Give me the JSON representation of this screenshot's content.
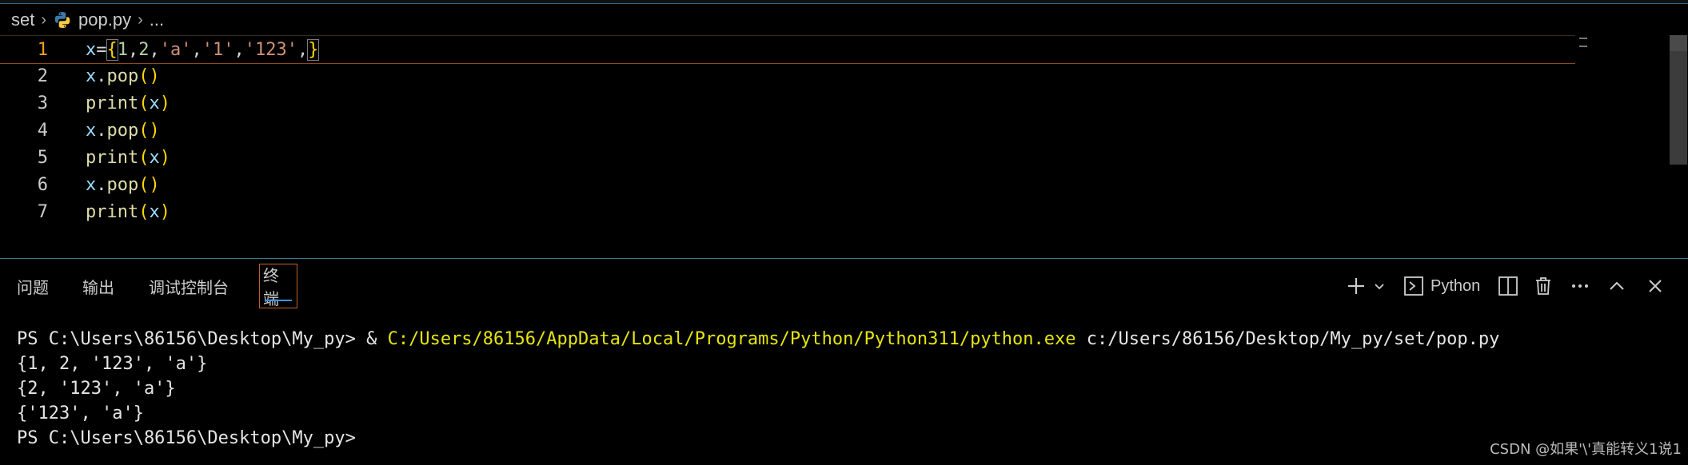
{
  "breadcrumb": {
    "folder": "set",
    "file": "pop.py",
    "more": "..."
  },
  "editor": {
    "lines": [
      {
        "num": "1",
        "tokens": [
          {
            "t": "x",
            "c": "var"
          },
          {
            "t": "=",
            "c": "op"
          },
          {
            "t": "{",
            "c": "brace"
          },
          {
            "t": "1",
            "c": "num"
          },
          {
            "t": ",",
            "c": "punc"
          },
          {
            "t": "2",
            "c": "num"
          },
          {
            "t": ",",
            "c": "punc"
          },
          {
            "t": "'a'",
            "c": "str"
          },
          {
            "t": ",",
            "c": "punc"
          },
          {
            "t": "'1'",
            "c": "str"
          },
          {
            "t": ",",
            "c": "punc"
          },
          {
            "t": "'123'",
            "c": "str"
          },
          {
            "t": ",",
            "c": "punc"
          },
          {
            "t": "}",
            "c": "brace"
          }
        ]
      },
      {
        "num": "2",
        "tokens": [
          {
            "t": "x",
            "c": "var"
          },
          {
            "t": ".",
            "c": "punc"
          },
          {
            "t": "pop",
            "c": "fn"
          },
          {
            "t": "()",
            "c": "paren"
          }
        ]
      },
      {
        "num": "3",
        "tokens": [
          {
            "t": "print",
            "c": "fn"
          },
          {
            "t": "(",
            "c": "paren"
          },
          {
            "t": "x",
            "c": "var"
          },
          {
            "t": ")",
            "c": "paren"
          }
        ]
      },
      {
        "num": "4",
        "tokens": [
          {
            "t": "x",
            "c": "var"
          },
          {
            "t": ".",
            "c": "punc"
          },
          {
            "t": "pop",
            "c": "fn"
          },
          {
            "t": "()",
            "c": "paren"
          }
        ]
      },
      {
        "num": "5",
        "tokens": [
          {
            "t": "print",
            "c": "fn"
          },
          {
            "t": "(",
            "c": "paren"
          },
          {
            "t": "x",
            "c": "var"
          },
          {
            "t": ")",
            "c": "paren"
          }
        ]
      },
      {
        "num": "6",
        "tokens": [
          {
            "t": "x",
            "c": "var"
          },
          {
            "t": ".",
            "c": "punc"
          },
          {
            "t": "pop",
            "c": "fn"
          },
          {
            "t": "()",
            "c": "paren"
          }
        ]
      },
      {
        "num": "7",
        "tokens": [
          {
            "t": "print",
            "c": "fn"
          },
          {
            "t": "(",
            "c": "paren"
          },
          {
            "t": "x",
            "c": "var"
          },
          {
            "t": ")",
            "c": "paren"
          }
        ]
      }
    ]
  },
  "panel": {
    "tabs": [
      "问题",
      "输出",
      "调试控制台",
      "终端"
    ],
    "active_tab": "终端",
    "terminal_profile": "Python"
  },
  "terminal": {
    "cmd_prompt": "PS C:\\Users\\86156\\Desktop\\My_py> ",
    "cmd_amp": "& ",
    "cmd_exe": "C:/Users/86156/AppData/Local/Programs/Python/Python311/python.exe",
    "cmd_arg": " c:/Users/86156/Desktop/My_py/set/pop.py",
    "output": [
      "{1, 2, '123', 'a'}",
      "{2, '123', 'a'}",
      "{'123', 'a'}"
    ],
    "final_prompt": "PS C:\\Users\\86156\\Desktop\\My_py>"
  },
  "watermark": "CSDN @如果'\\'真能转义1说1",
  "colors": {
    "background": "#000000",
    "current_line_number": "#f0a020",
    "active_tab_border": "#c0622b",
    "exe_path": "#e5e510"
  }
}
